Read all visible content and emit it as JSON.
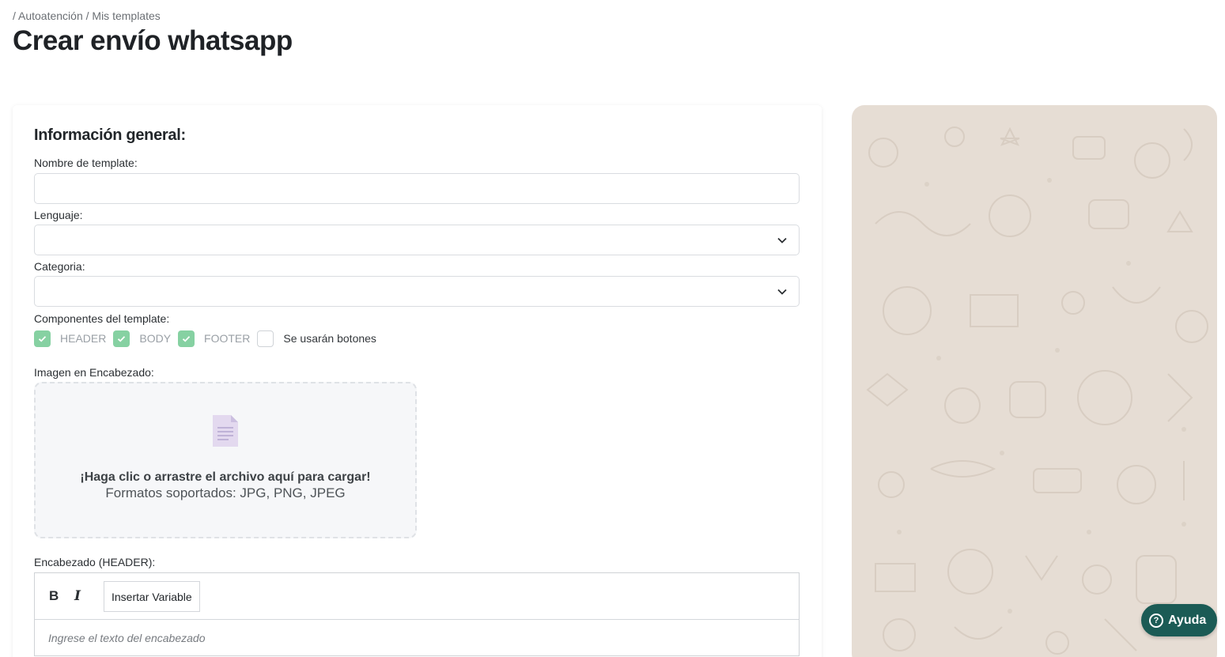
{
  "breadcrumb": "/ Autoatención / Mis templates",
  "page_title": "Crear envío whatsapp",
  "form": {
    "section_title": "Información general:",
    "template_name_label": "Nombre de template:",
    "template_name_value": "",
    "language_label": "Lenguaje:",
    "language_value": "",
    "category_label": "Categoria:",
    "category_value": "",
    "components_label": "Componentes del template:",
    "components": [
      {
        "label": "HEADER",
        "checked": true
      },
      {
        "label": "BODY",
        "checked": true
      },
      {
        "label": "FOOTER",
        "checked": true
      },
      {
        "label": "Se usarán botones",
        "checked": false
      }
    ],
    "header_image_label": "Imagen en Encabezado:",
    "dropzone_title": "¡Haga clic o arrastre el archivo aquí para cargar!",
    "dropzone_formats": "Formatos soportados: JPG, PNG, JPEG",
    "header_text_label": "Encabezado (HEADER):",
    "editor": {
      "bold": "B",
      "italic": "I",
      "insert_variable": "Insertar Variable",
      "placeholder": "Ingrese el texto del encabezado"
    }
  },
  "help_button": "Ayuda",
  "colors": {
    "check_green": "#86d1a2",
    "help_button_bg": "#1b5b55",
    "preview_bg": "#e6ddd4"
  },
  "icons": [
    "check-icon",
    "chevron-down-icon",
    "file-icon",
    "help-icon"
  ]
}
